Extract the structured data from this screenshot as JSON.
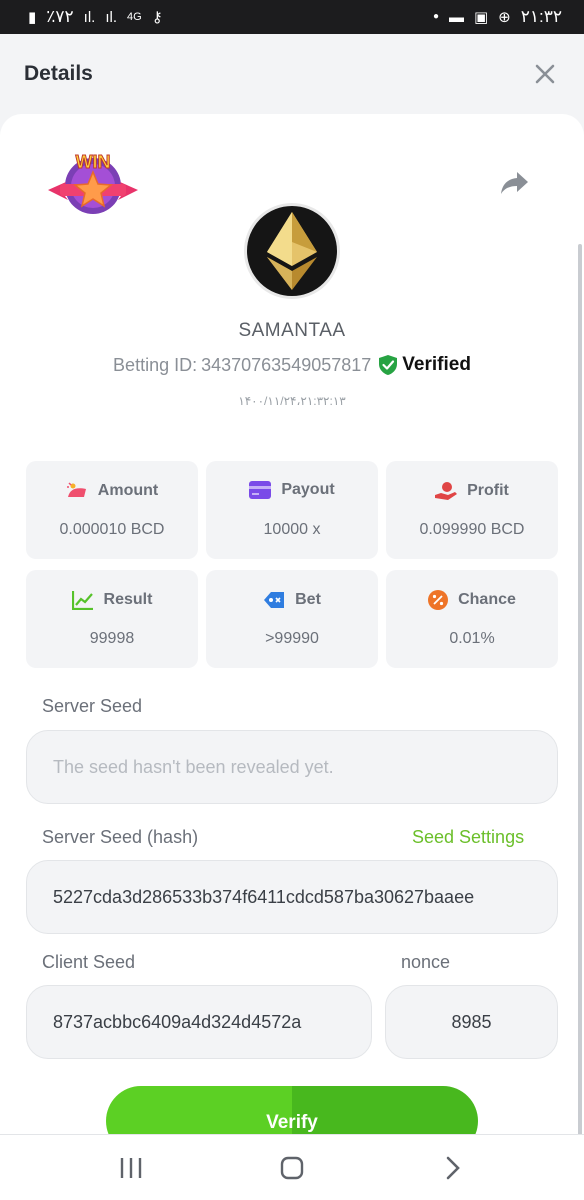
{
  "status_bar": {
    "battery": "٪۷۲",
    "network": "4G",
    "time": "۲۱:۳۲"
  },
  "header": {
    "title": "Details"
  },
  "profile": {
    "username": "SAMANTAA",
    "betting_id_label": "Betting ID:",
    "betting_id": "34370763549057817",
    "verified_label": "Verified",
    "date": "۱۴۰۰/۱۱/۲۴،۲۱:۳۲:۱۳",
    "logo_text": "WIN"
  },
  "stats": [
    {
      "label": "Amount",
      "value": "0.000010 BCD",
      "icon": "amount-icon",
      "color": "#ef4f6e"
    },
    {
      "label": "Payout",
      "value": "10000 x",
      "icon": "payout-card-icon",
      "color": "#7a4be8"
    },
    {
      "label": "Profit",
      "value": "0.099990 BCD",
      "icon": "profit-hand-icon",
      "color": "#e04545"
    },
    {
      "label": "Result",
      "value": "99998",
      "icon": "result-chart-icon",
      "color": "#56c22a"
    },
    {
      "label": "Bet",
      "value": ">99990",
      "icon": "bet-tag-icon",
      "color": "#2f7de0"
    },
    {
      "label": "Chance",
      "value": "0.01%",
      "icon": "chance-percent-icon",
      "color": "#ee7428"
    }
  ],
  "server_seed": {
    "label": "Server Seed",
    "placeholder": "The seed hasn't been revealed yet."
  },
  "server_seed_hash": {
    "label": "Server Seed (hash)",
    "link": "Seed Settings",
    "value": "5227cda3d286533b374f6411cdcd587ba30627baaee"
  },
  "client_seed": {
    "label": "Client Seed",
    "value": "8737acbbc6409a4d324d4572a"
  },
  "nonce": {
    "label": "nonce",
    "value": "8985"
  },
  "verify_button": "Verify",
  "colors": {
    "accent_green": "#5cd024",
    "link_green": "#6bbf2a",
    "verified_green": "#27a343"
  }
}
